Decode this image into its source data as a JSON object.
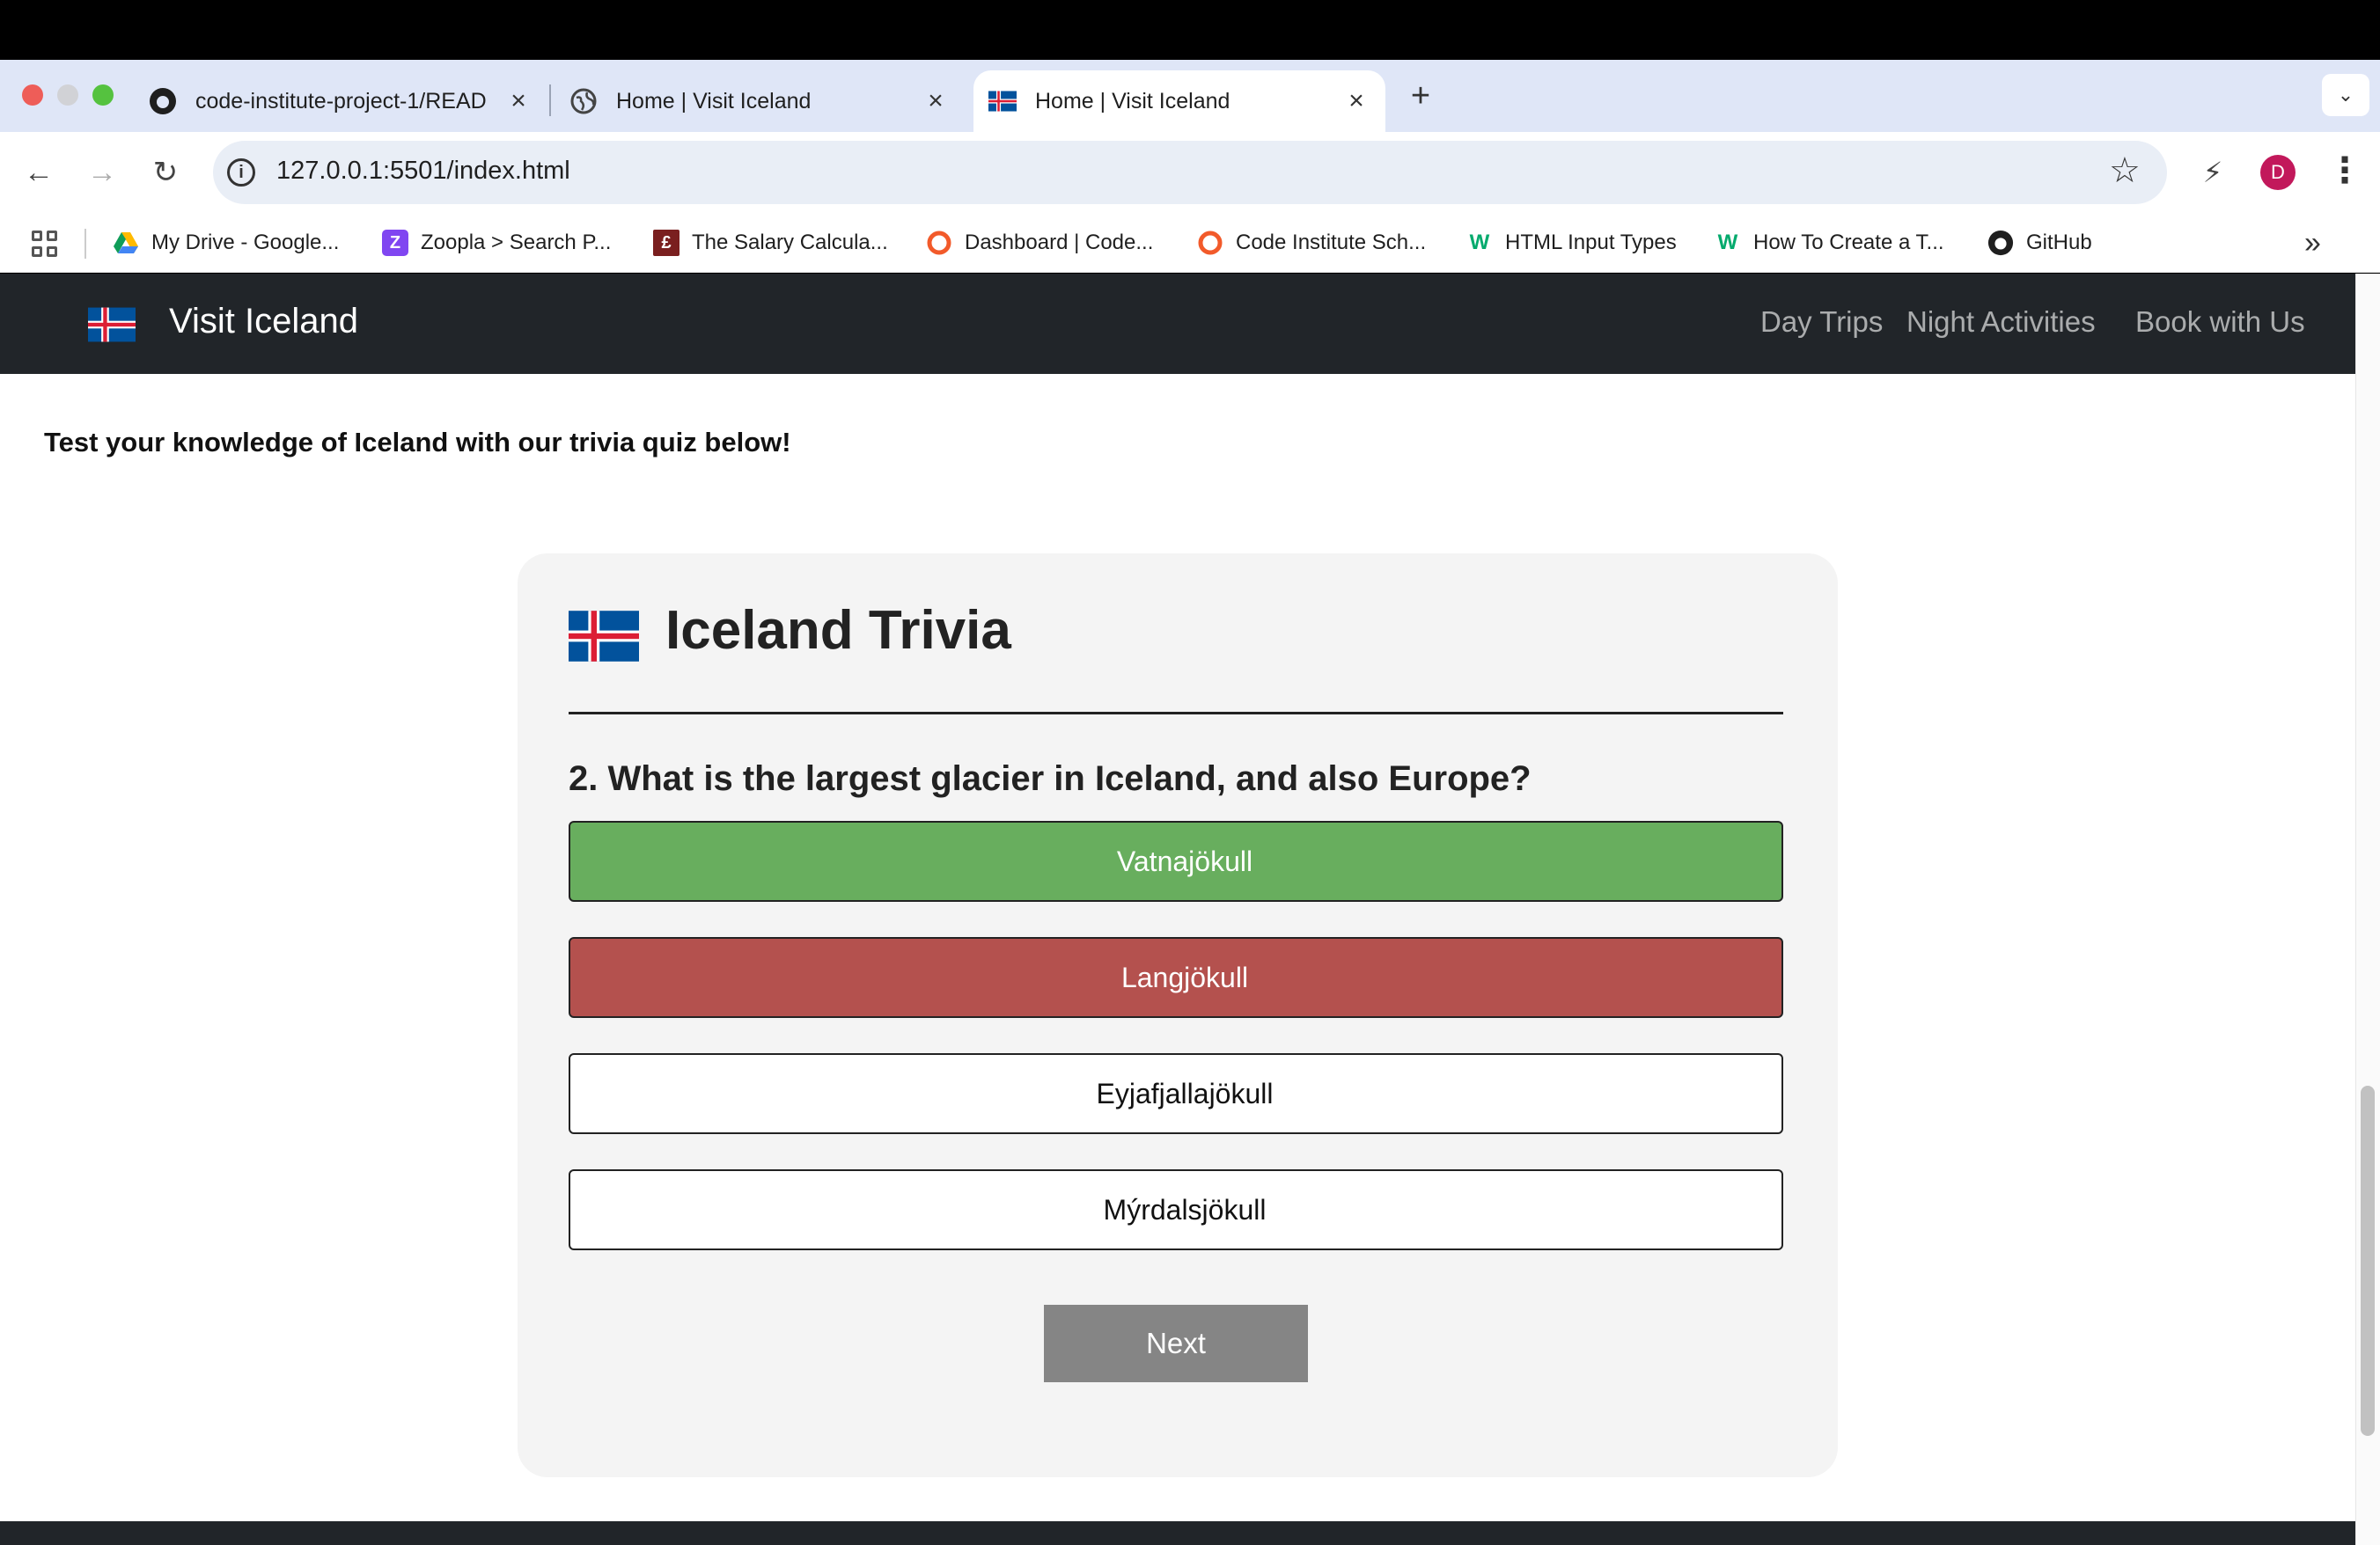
{
  "browser": {
    "tabs": [
      {
        "title": "code-institute-project-1/README",
        "favicon": "github-icon"
      },
      {
        "title": "Home | Visit Iceland",
        "favicon": "globe-icon"
      },
      {
        "title": "Home | Visit Iceland",
        "favicon": "iceland-flag-icon",
        "active": true
      }
    ],
    "url": "127.0.0.1:5501/index.html",
    "profile_initial": "D",
    "bookmarks": [
      {
        "label": "My Drive - Google...",
        "icon": "google-drive-icon"
      },
      {
        "label": "Zoopla > Search P...",
        "icon": "zoopla-icon"
      },
      {
        "label": "The Salary Calcula...",
        "icon": "pound-icon"
      },
      {
        "label": "Dashboard | Code...",
        "icon": "code-institute-icon"
      },
      {
        "label": "Code Institute Sch...",
        "icon": "code-institute-icon"
      },
      {
        "label": "HTML Input Types",
        "icon": "w3schools-icon"
      },
      {
        "label": "How To Create a T...",
        "icon": "w3schools-icon"
      },
      {
        "label": "GitHub",
        "icon": "github-icon"
      }
    ]
  },
  "site": {
    "brand": "Visit Iceland",
    "nav": [
      "Day Trips",
      "Night Activities",
      "Book with Us"
    ],
    "intro": "Test your knowledge of Iceland with our trivia quiz below!"
  },
  "quiz": {
    "title": "Iceland Trivia",
    "question": "2. What is the largest glacier in Iceland, and also Europe?",
    "answers": [
      {
        "text": "Vatnajökull",
        "state": "correct"
      },
      {
        "text": "Langjökull",
        "state": "wrong"
      },
      {
        "text": "Eyjafjallajökull",
        "state": "neutral"
      },
      {
        "text": "Mýrdalsjökull",
        "state": "neutral"
      }
    ],
    "next_label": "Next"
  },
  "colors": {
    "navbar": "#212529",
    "correct": "#68ae5e",
    "wrong": "#b4514e",
    "next_button": "#858585",
    "card": "#f4f4f4"
  }
}
